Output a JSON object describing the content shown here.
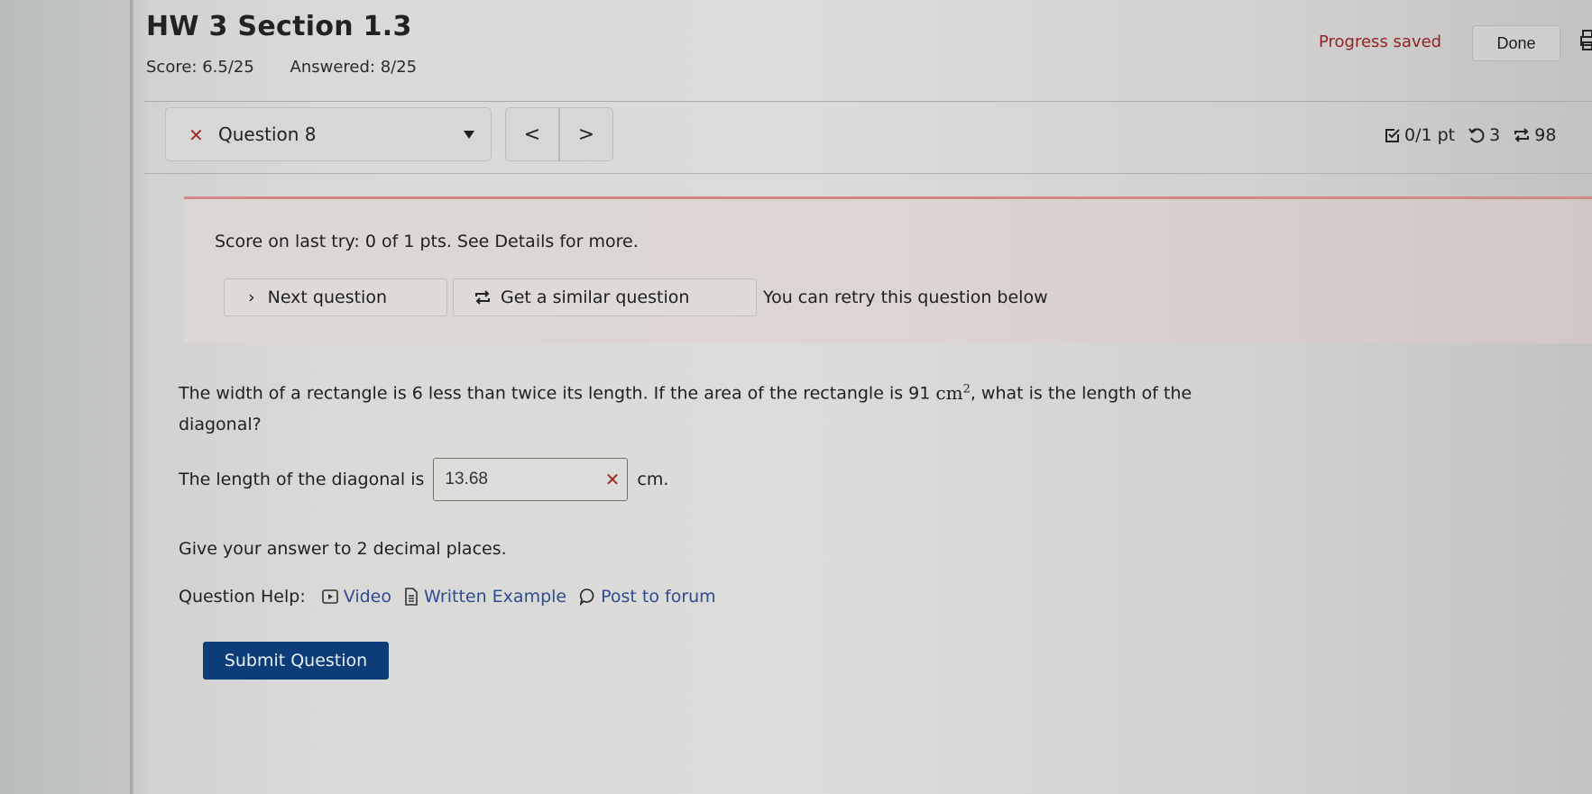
{
  "header": {
    "title": "HW 3 Section 1.3",
    "score": "Score: 6.5/25",
    "answered": "Answered: 8/25",
    "progress_status": "Progress saved",
    "done_label": "Done"
  },
  "question_nav": {
    "selected_question": "Question 8",
    "status_icon": "x-mark-icon",
    "prev_label": "<",
    "next_label": ">"
  },
  "stats": {
    "points": "0/1 pt",
    "retries": "3",
    "versions": "98"
  },
  "feedback": {
    "message": "Score on last try: 0 of 1 pts. See Details for more.",
    "next_question_label": "Next question",
    "similar_question_label": "Get a similar question",
    "retry_message": "You can retry this question below"
  },
  "question": {
    "text_before": "The width of a rectangle is 6 less than twice its length. If the area of the rectangle is 91",
    "unit": "cm",
    "exponent": "2",
    "text_after": ", what is the length of the diagonal?",
    "answer_prefix": "The length of the diagonal is",
    "answer_value": "13.68",
    "answer_unit": "cm.",
    "instruction": "Give your answer to 2 decimal places."
  },
  "help": {
    "label": "Question Help:",
    "links": [
      {
        "label": "Video",
        "icon": "video-icon"
      },
      {
        "label": "Written Example",
        "icon": "document-icon"
      },
      {
        "label": "Post to forum",
        "icon": "chat-bubble-icon"
      }
    ]
  },
  "submit_label": "Submit Question",
  "colors": {
    "accent": "#0d3d78",
    "error": "#9a2b22",
    "progress_saved": "#8f2424",
    "link": "#2f4a8f"
  }
}
